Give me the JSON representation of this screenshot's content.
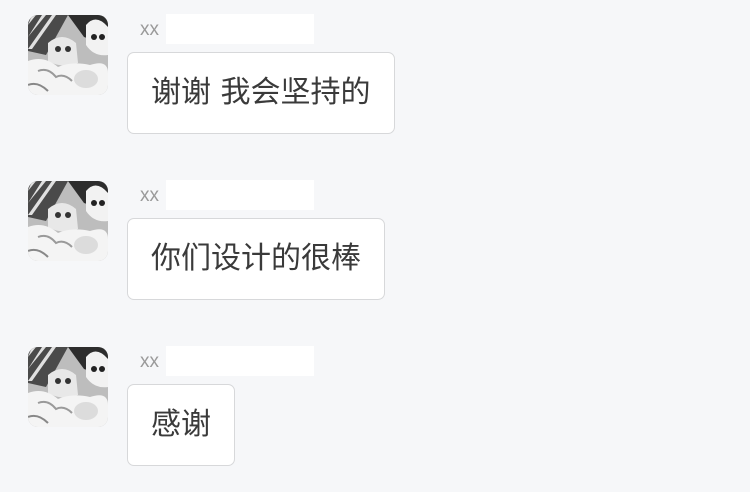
{
  "messages": [
    {
      "sender": "xx",
      "text": "谢谢 我会坚持的"
    },
    {
      "sender": "xx",
      "text": "你们设计的很棒"
    },
    {
      "sender": "xx",
      "text": "感谢"
    }
  ],
  "colors": {
    "background": "#f6f7f9",
    "bubble": "#ffffff",
    "bubble_border": "#d7d8da",
    "text": "#3a3a3a",
    "sender": "#9a9a9a"
  },
  "icons": {
    "avatar": "cat-photo-avatar"
  }
}
